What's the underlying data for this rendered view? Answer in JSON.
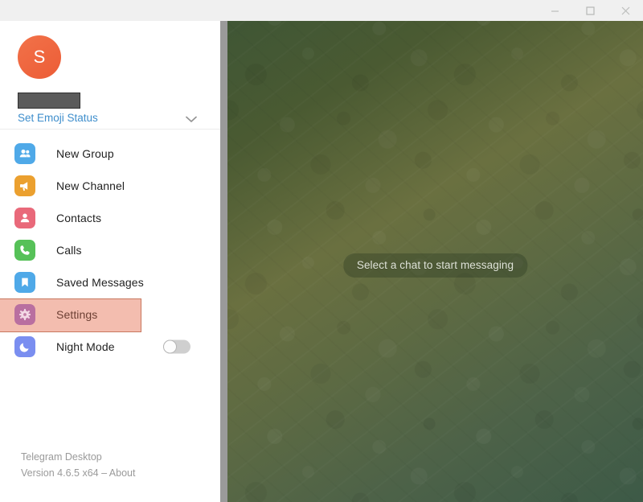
{
  "titlebar": {
    "minimize_label": "Minimize",
    "maximize_label": "Maximize",
    "close_label": "Close"
  },
  "profile": {
    "avatar_initial": "S",
    "name_redacted": "",
    "emoji_status_label": "Set Emoji Status",
    "accent_color": "#f0663f",
    "link_color": "#3e8ecc"
  },
  "menu": {
    "items": [
      {
        "label": "New Group",
        "icon": "group-icon",
        "color": "#4fa9e8",
        "selected": false,
        "toggle": null
      },
      {
        "label": "New Channel",
        "icon": "megaphone-icon",
        "color": "#eba02f",
        "selected": false,
        "toggle": null
      },
      {
        "label": "Contacts",
        "icon": "contact-icon",
        "color": "#e9697a",
        "selected": false,
        "toggle": null
      },
      {
        "label": "Calls",
        "icon": "phone-icon",
        "color": "#56c158",
        "selected": false,
        "toggle": null
      },
      {
        "label": "Saved Messages",
        "icon": "bookmark-icon",
        "color": "#4fa9e8",
        "selected": false,
        "toggle": null
      },
      {
        "label": "Settings",
        "icon": "gear-icon",
        "color": "#b96fa0",
        "selected": true,
        "toggle": null
      },
      {
        "label": "Night Mode",
        "icon": "moon-icon",
        "color": "#7a8ef0",
        "selected": false,
        "toggle": "off"
      }
    ],
    "selection_color": "#e77c60"
  },
  "footer": {
    "app_name": "Telegram Desktop",
    "version_line": "Version 4.6.5 x64 – About"
  },
  "chat": {
    "empty_state_label": "Select a chat to start messaging",
    "background_colors": [
      "#3f5635",
      "#6a7040",
      "#3d5a47"
    ]
  }
}
